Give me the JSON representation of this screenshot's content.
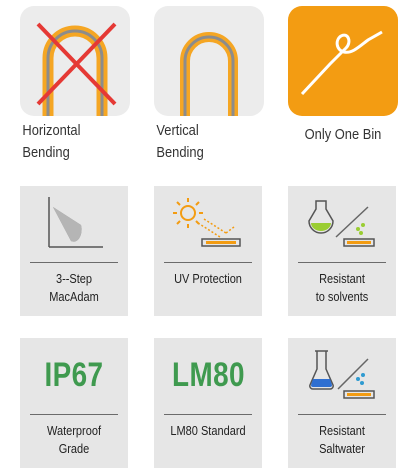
{
  "top_row": [
    {
      "label": "Horizontal\nBending",
      "icon": "horizontal-bending-crossed-icon"
    },
    {
      "label": "Vertical\nBending",
      "icon": "vertical-bending-icon"
    },
    {
      "label": "Only One Bin",
      "icon": "color-bin-curve-icon"
    }
  ],
  "middle_row": [
    {
      "caption": "3--Step\nMacAdam",
      "icon": "macadam-cone-icon"
    },
    {
      "caption": "UV Protection",
      "icon": "sun-uv-icon"
    },
    {
      "caption": "Resistant\nto solvents",
      "icon": "solvent-flask-icon"
    }
  ],
  "bottom_row": [
    {
      "code": "IP67",
      "caption": "Waterproof\nGrade"
    },
    {
      "code": "LM80",
      "caption": "LM80 Standard"
    },
    {
      "caption": "Resistant\nSaltwater",
      "icon": "saltwater-beaker-icon"
    }
  ],
  "colors": {
    "accent_orange": "#f39c12",
    "code_green": "#3f9a4f",
    "cross_red": "#e53935",
    "tile_gray": "#e6e6e6"
  }
}
